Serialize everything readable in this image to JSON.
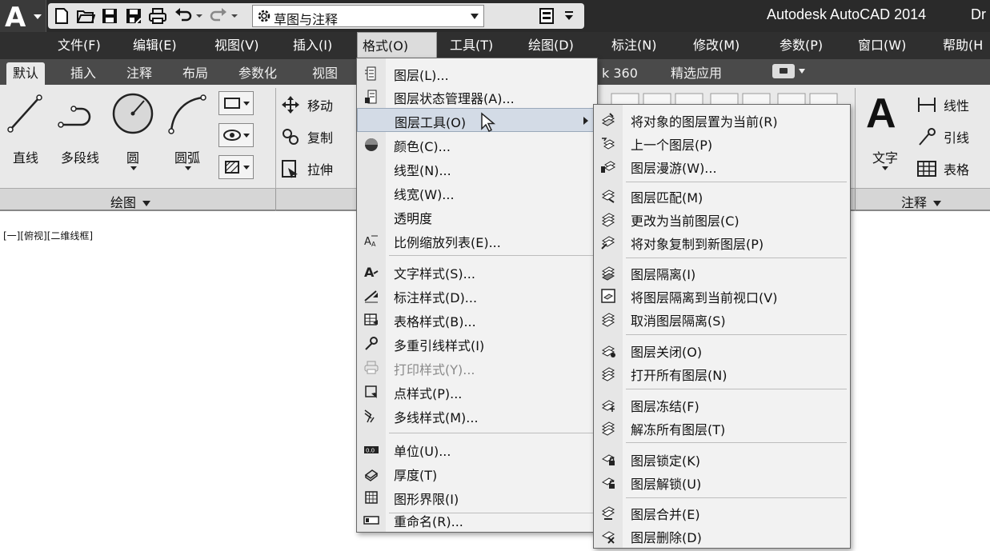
{
  "title_bar": {
    "workspace": "草图与注释",
    "app_title": "Autodesk AutoCAD 2014",
    "app_title_cut": "Dr"
  },
  "menubar": [
    {
      "label": "文件(F)"
    },
    {
      "label": "编辑(E)"
    },
    {
      "label": "视图(V)"
    },
    {
      "label": "插入(I)"
    },
    {
      "label": "格式(O)"
    },
    {
      "label": "工具(T)"
    },
    {
      "label": "绘图(D)"
    },
    {
      "label": "标注(N)"
    },
    {
      "label": "修改(M)"
    },
    {
      "label": "参数(P)"
    },
    {
      "label": "窗口(W)"
    },
    {
      "label": "帮助(H"
    }
  ],
  "ribbon_tabs": [
    {
      "label": "默认"
    },
    {
      "label": "插入"
    },
    {
      "label": "注释"
    },
    {
      "label": "布局"
    },
    {
      "label": "参数化"
    },
    {
      "label": "视图"
    },
    {
      "label": "k 360"
    },
    {
      "label": "精选应用"
    }
  ],
  "draw_panel": {
    "tools": [
      {
        "label": "直线"
      },
      {
        "label": "多段线"
      },
      {
        "label": "圆"
      },
      {
        "label": "圆弧"
      }
    ],
    "title": "绘图"
  },
  "modify_panel": {
    "items": [
      {
        "label": "移动"
      },
      {
        "label": "复制"
      },
      {
        "label": "拉伸"
      }
    ]
  },
  "annotation_panel": {
    "text_label": "文字",
    "big_letter": "A",
    "items": [
      {
        "label": "线性"
      },
      {
        "label": "引线"
      },
      {
        "label": "表格"
      }
    ],
    "title": "注释"
  },
  "viewport": {
    "label": "[一][俯视][二维线框]"
  },
  "format_menu": {
    "items": [
      {
        "label": "图层(L)..."
      },
      {
        "label": "图层状态管理器(A)..."
      },
      {
        "label": "图层工具(O)"
      },
      {
        "label": "颜色(C)..."
      },
      {
        "label": "线型(N)..."
      },
      {
        "label": "线宽(W)..."
      },
      {
        "label": "透明度"
      },
      {
        "label": "比例缩放列表(E)..."
      },
      {
        "label": "文字样式(S)..."
      },
      {
        "label": "标注样式(D)..."
      },
      {
        "label": "表格样式(B)..."
      },
      {
        "label": "多重引线样式(I)"
      },
      {
        "label": "打印样式(Y)..."
      },
      {
        "label": "点样式(P)..."
      },
      {
        "label": "多线样式(M)..."
      },
      {
        "label": "单位(U)..."
      },
      {
        "label": "厚度(T)"
      },
      {
        "label": "图形界限(I)"
      },
      {
        "label": "重命名(R)..."
      }
    ]
  },
  "layer_tools_menu": {
    "items": [
      {
        "label": "将对象的图层置为当前(R)"
      },
      {
        "label": "上一个图层(P)"
      },
      {
        "label": "图层漫游(W)..."
      },
      {
        "label": "图层匹配(M)"
      },
      {
        "label": "更改为当前图层(C)"
      },
      {
        "label": "将对象复制到新图层(P)"
      },
      {
        "label": "图层隔离(I)"
      },
      {
        "label": "将图层隔离到当前视口(V)"
      },
      {
        "label": "取消图层隔离(S)"
      },
      {
        "label": "图层关闭(O)"
      },
      {
        "label": "打开所有图层(N)"
      },
      {
        "label": "图层冻结(F)"
      },
      {
        "label": "解冻所有图层(T)"
      },
      {
        "label": "图层锁定(K)"
      },
      {
        "label": "图层解锁(U)"
      },
      {
        "label": "图层合并(E)"
      },
      {
        "label": "图层删除(D)"
      }
    ]
  }
}
